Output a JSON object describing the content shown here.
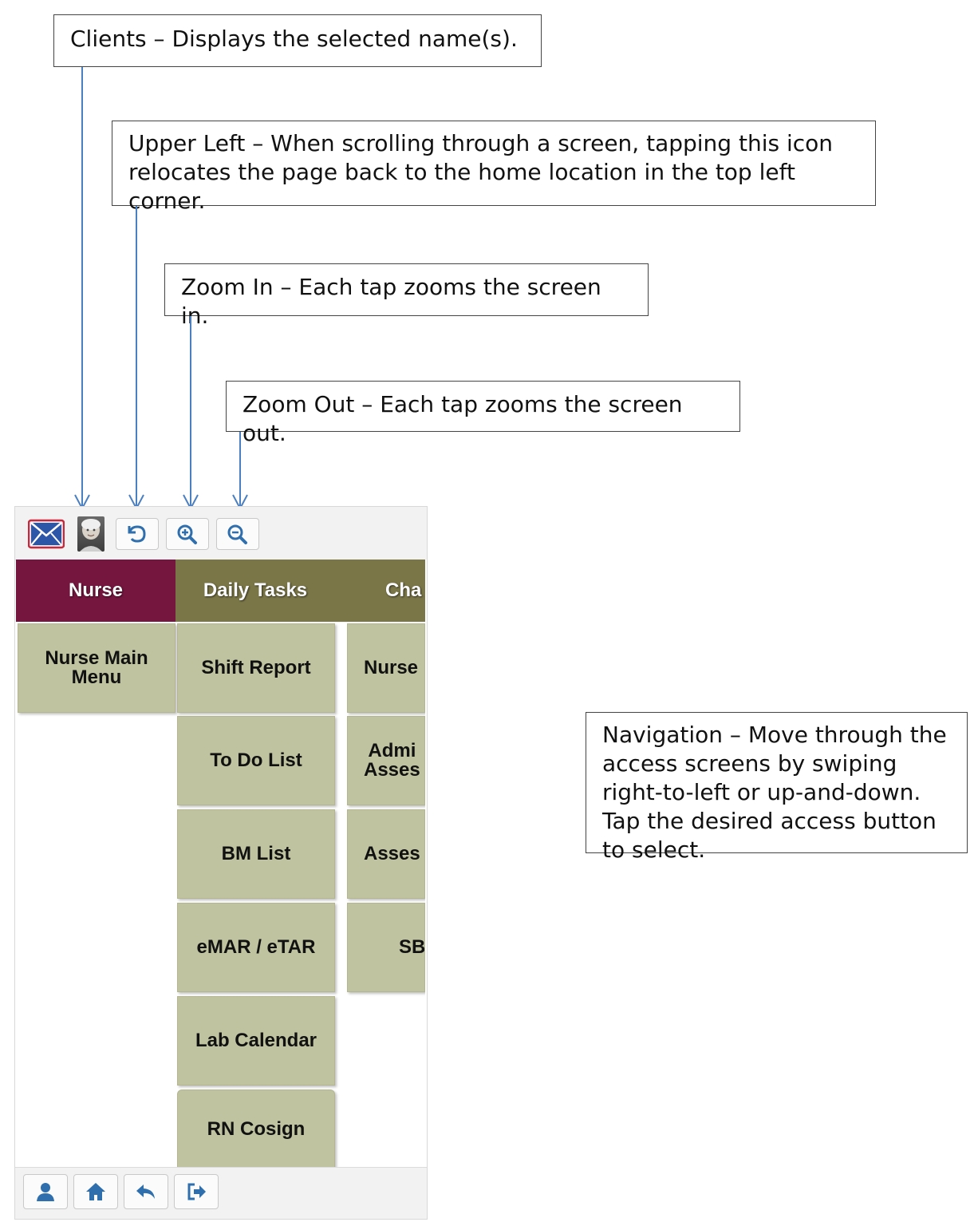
{
  "callouts": {
    "clients": {
      "term": "Clients",
      "text": " – Displays the selected name(s)."
    },
    "upper_left": {
      "term": "Upper Left",
      "text": " – When scrolling through a screen, tapping this icon relocates the page back to the home location in the top left corner."
    },
    "zoom_in": {
      "term": "Zoom In",
      "text": " – Each tap zooms the screen in."
    },
    "zoom_out": {
      "term": "Zoom Out",
      "text": " – Each tap zooms the screen out."
    },
    "navigation": {
      "term": "Navigation",
      "text": " – Move through the access screens by swiping right-to-left or up-and-down. Tap the desired access button to select."
    }
  },
  "toolbar": {
    "icons": [
      "mail-icon",
      "client-photo",
      "upper-left-icon",
      "zoom-in-icon",
      "zoom-out-icon"
    ]
  },
  "tabs": {
    "nurse": "Nurse",
    "daily_tasks": "Daily Tasks",
    "charting": "Cha"
  },
  "nurse_column": [
    "Nurse Main\nMenu"
  ],
  "daily_tasks_column": [
    "Shift Report",
    "To Do List",
    "BM List",
    "eMAR / eTAR",
    "Lab Calendar",
    "RN Cosign"
  ],
  "charting_column": [
    "Nurse",
    "Admi\nAsses",
    "Asses",
    "SB"
  ],
  "bottom_bar": {
    "icons": [
      "user-icon",
      "home-icon",
      "back-icon",
      "logout-icon"
    ]
  },
  "colors": {
    "nurse_tab": "#75163f",
    "daily_tab": "#7a7648",
    "tile": "#c0c3a0",
    "icon_blue": "#2f6fad",
    "arrow": "#4a7fc1"
  }
}
